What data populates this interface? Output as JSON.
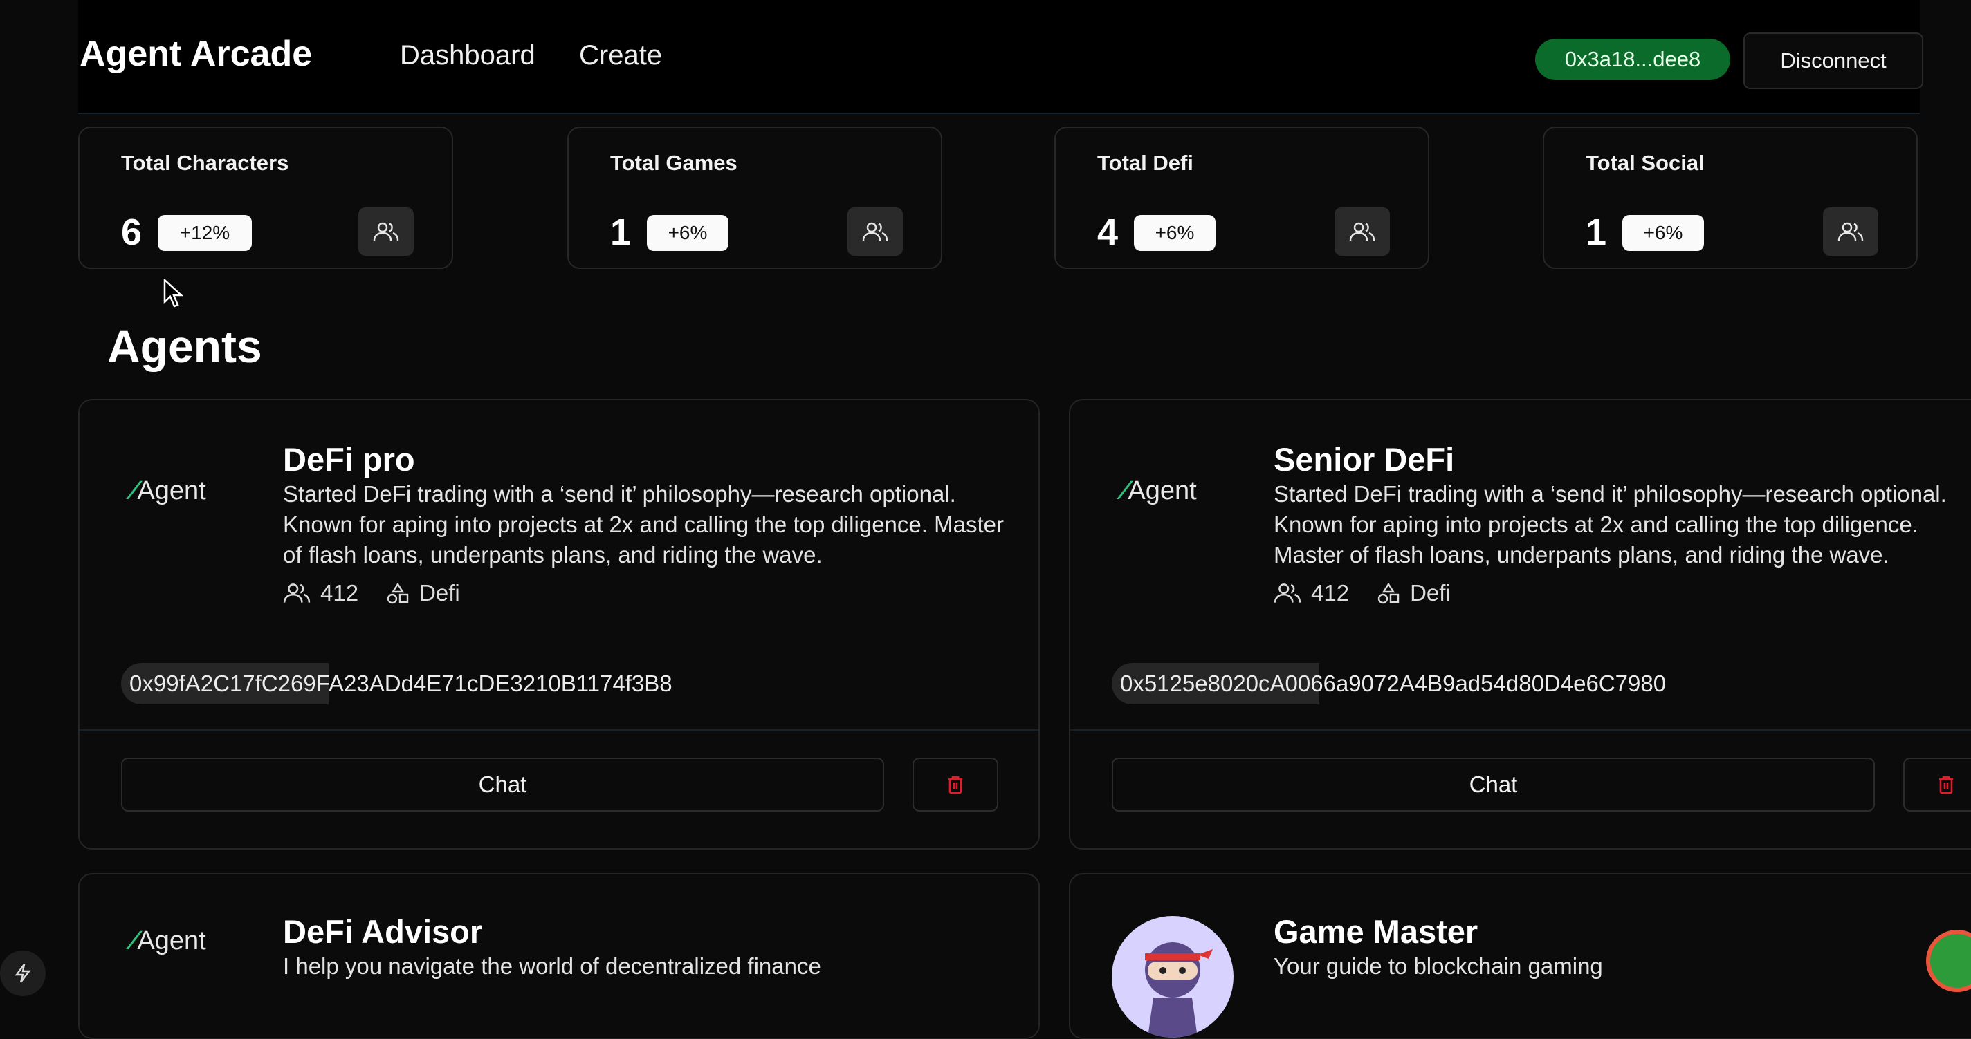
{
  "header": {
    "brand": "Agent Arcade",
    "nav": [
      "Dashboard",
      "Create"
    ],
    "wallet": "0x3a18...dee8",
    "disconnect": "Disconnect"
  },
  "stats": [
    {
      "title": "Total Characters",
      "value": "6",
      "badge": "+12%",
      "icon": "users-icon"
    },
    {
      "title": "Total Games",
      "value": "1",
      "badge": "+6%",
      "icon": "users-icon"
    },
    {
      "title": "Total Defi",
      "value": "4",
      "badge": "+6%",
      "icon": "users-icon"
    },
    {
      "title": "Total Social",
      "value": "1",
      "badge": "+6%",
      "icon": "users-icon"
    }
  ],
  "section_title": "Agents",
  "agents": [
    {
      "logo": "Agent",
      "name": "DeFi pro",
      "description": "Started DeFi trading with a ‘send it’ philosophy—research optional. Known for aping into projects at 2x and calling the top diligence. Master of flash loans, underpants plans, and riding the wave.",
      "followers": "412",
      "category": "Defi",
      "address": "0x99fA2C17fC269FA23ADd4E71cDE3210B1174f3B8",
      "chat": "Chat"
    },
    {
      "logo": "Agent",
      "name": "Senior DeFi",
      "description": "Started DeFi trading with a ‘send it’ philosophy—research optional. Known for aping into projects at 2x and calling the top diligence. Master of flash loans, underpants plans, and riding the wave.",
      "followers": "412",
      "category": "Defi",
      "address": "0x5125e8020cA0066a9072A4B9ad54d80D4e6C7980",
      "chat": "Chat"
    },
    {
      "logo": "Agent",
      "name": "DeFi Advisor",
      "description": "I help you navigate the world of decentralized finance"
    },
    {
      "avatar": "ninja-avatar",
      "name": "Game Master",
      "description": "Your guide to blockchain gaming"
    }
  ],
  "colors": {
    "background": "#0a0a0a",
    "wallet_bg": "#0b6b2b",
    "delete": "#e11d2a",
    "logo_accent": "#2ec27e"
  }
}
